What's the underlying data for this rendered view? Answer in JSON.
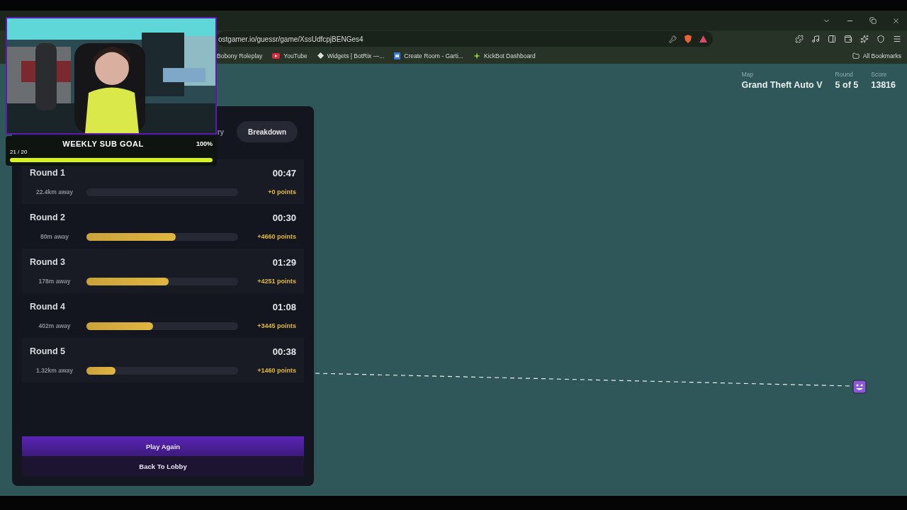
{
  "browser": {
    "url": "ostgamer.io/guessr/game/XssUdfcpjBENGes4",
    "bookmarks": [
      {
        "label": "Bobony Roleplay",
        "kind": "plain"
      },
      {
        "label": "YouTube",
        "kind": "video"
      },
      {
        "label": "Widgets | BotRix —...",
        "kind": "widget"
      },
      {
        "label": "Create Room - Garti...",
        "kind": "doc"
      },
      {
        "label": "KickBot Dashboard",
        "kind": "bot"
      }
    ],
    "all_bookmarks": "All Bookmarks"
  },
  "stats": [
    {
      "label": "Map",
      "value": "Grand Theft Auto V"
    },
    {
      "label": "Round",
      "value": "5 of 5"
    },
    {
      "label": "Score",
      "value": "13816"
    }
  ],
  "summary": {
    "tabs": [
      {
        "label": "ry",
        "selected": false
      },
      {
        "label": "Breakdown",
        "selected": true
      }
    ],
    "rounds": [
      {
        "title": "Round 1",
        "time": "00:47",
        "distance": "22.4km away",
        "level": 0,
        "points": "+0 points"
      },
      {
        "title": "Round 2",
        "time": "00:30",
        "distance": "80m away",
        "level": 0.59,
        "points": "+4660 points"
      },
      {
        "title": "Round 3",
        "time": "01:29",
        "distance": "178m away",
        "level": 0.54,
        "points": "+4251 points"
      },
      {
        "title": "Round 4",
        "time": "01:08",
        "distance": "402m away",
        "level": 0.44,
        "points": "+3445 points"
      },
      {
        "title": "Round 5",
        "time": "00:38",
        "distance": "1.32km away",
        "level": 0.19,
        "points": "+1460 points"
      }
    ],
    "buttons": [
      {
        "label": "Play Again",
        "kind": "primary"
      },
      {
        "label": "Back To Lobby",
        "kind": "secondary"
      }
    ]
  },
  "overlay": {
    "goal": {
      "title": "WEEKLY SUB GOAL",
      "percent": "100%",
      "count": "21 / 20",
      "level": 1
    }
  }
}
